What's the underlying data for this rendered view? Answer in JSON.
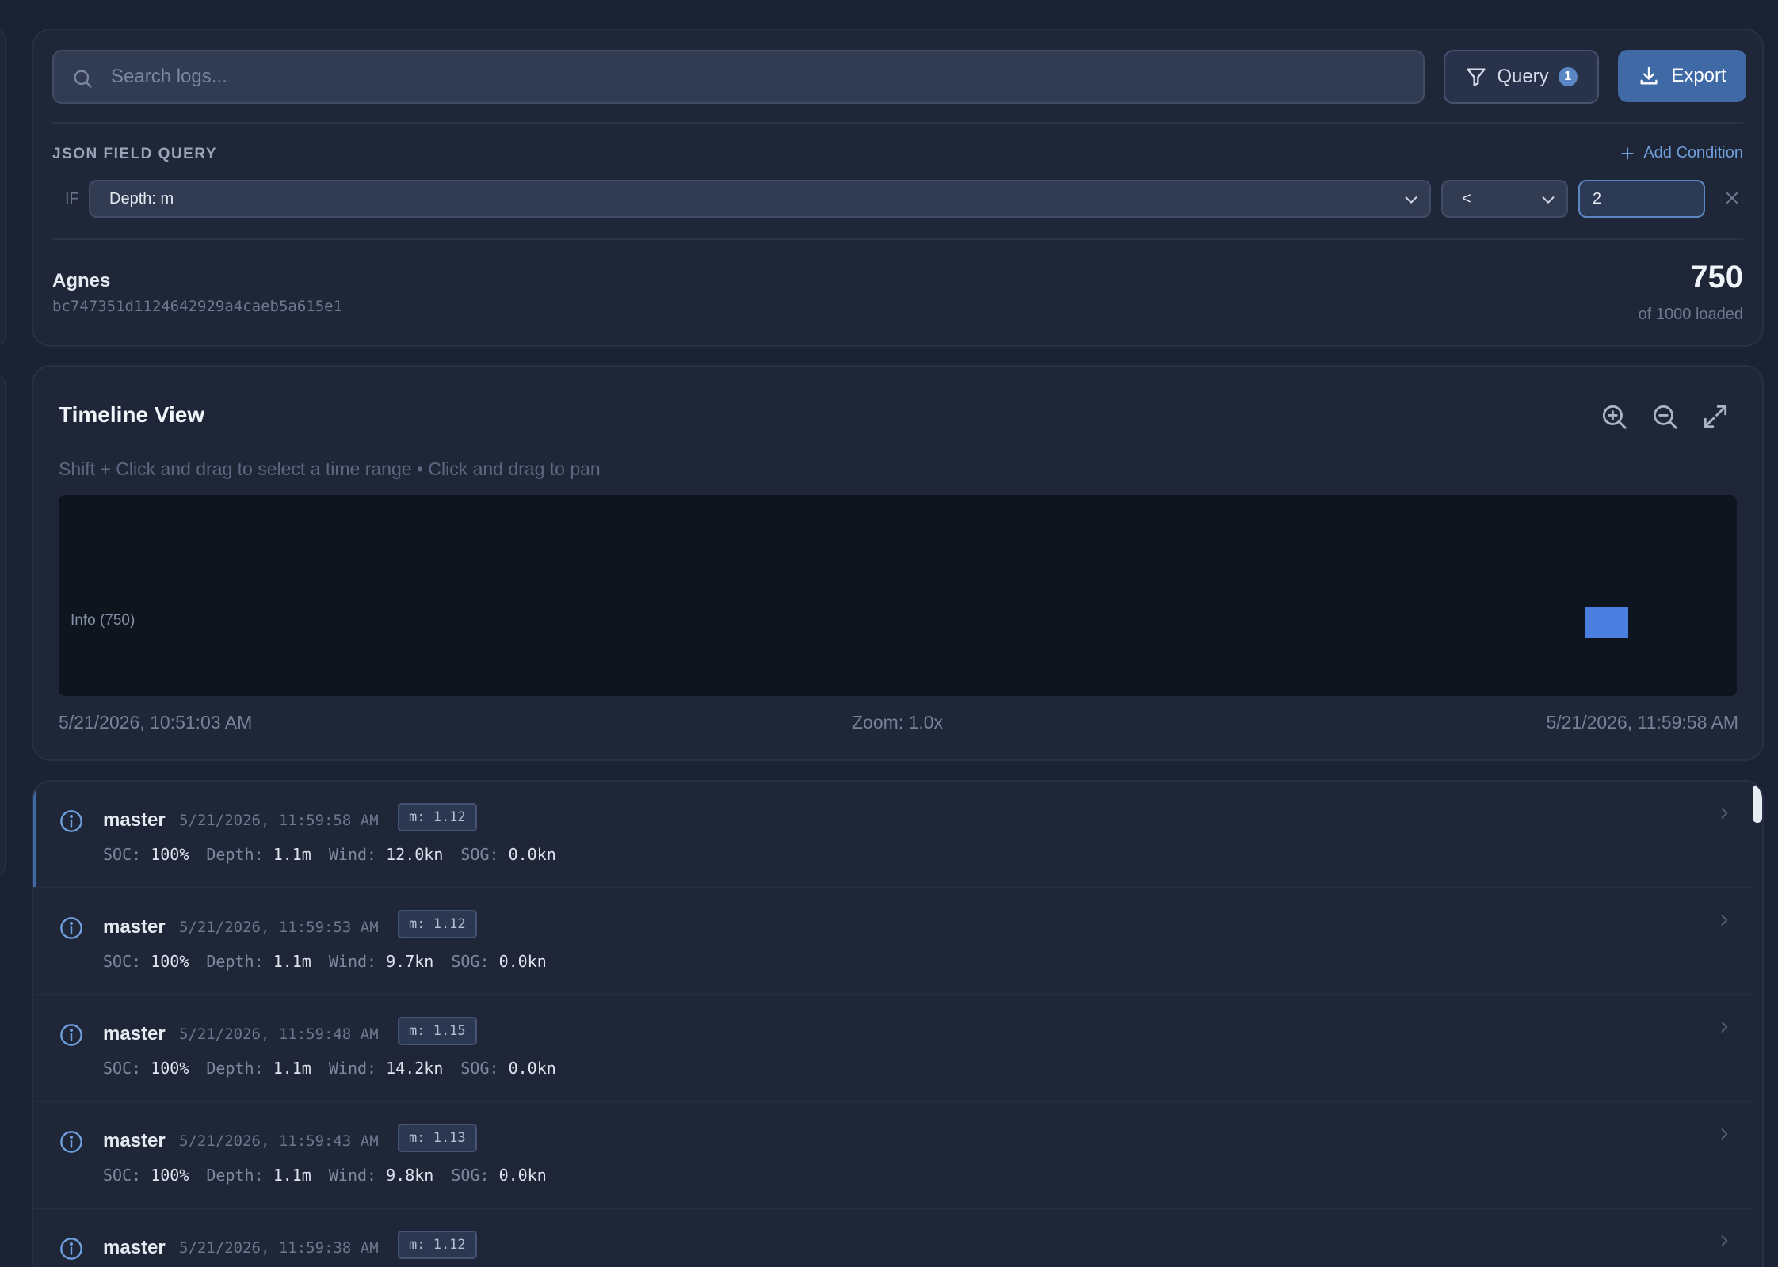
{
  "search": {
    "placeholder": "Search logs..."
  },
  "toolbar": {
    "query_label": "Query",
    "query_count": "1",
    "export_label": "Export"
  },
  "json_query": {
    "title": "JSON FIELD QUERY",
    "add_label": "Add Condition",
    "if_label": "IF",
    "field": "Depth: m",
    "operator": "<",
    "value": "2"
  },
  "source": {
    "name": "Agnes",
    "id": "bc747351d1124642929a4caeb5a615e1"
  },
  "counts": {
    "shown": "750",
    "loaded_text": "of 1000 loaded"
  },
  "timeline": {
    "title": "Timeline View",
    "hint": "Shift + Click and drag to select a time range • Click and drag to pan",
    "series_label": "Info (750)",
    "start": "5/21/2026, 10:51:03 AM",
    "zoom": "Zoom: 1.0x",
    "end": "5/21/2026, 11:59:58 AM",
    "colors": {
      "bar": "#4a7fe0",
      "canvas": "#0f151f"
    },
    "icons": [
      "zoom-in-icon",
      "zoom-out-icon",
      "expand-icon"
    ]
  },
  "logs": [
    {
      "source": "master",
      "time": "5/21/2026, 11:59:58 AM",
      "tag": "m: 1.12",
      "soc_k": "SOC:",
      "soc": "100%",
      "depth_k": "Depth:",
      "depth": "1.1m",
      "wind_k": "Wind:",
      "wind": "12.0kn",
      "sog_k": "SOG:",
      "sog": "0.0kn"
    },
    {
      "source": "master",
      "time": "5/21/2026, 11:59:53 AM",
      "tag": "m: 1.12",
      "soc_k": "SOC:",
      "soc": "100%",
      "depth_k": "Depth:",
      "depth": "1.1m",
      "wind_k": "Wind:",
      "wind": "9.7kn",
      "sog_k": "SOG:",
      "sog": "0.0kn"
    },
    {
      "source": "master",
      "time": "5/21/2026, 11:59:48 AM",
      "tag": "m: 1.15",
      "soc_k": "SOC:",
      "soc": "100%",
      "depth_k": "Depth:",
      "depth": "1.1m",
      "wind_k": "Wind:",
      "wind": "14.2kn",
      "sog_k": "SOG:",
      "sog": "0.0kn"
    },
    {
      "source": "master",
      "time": "5/21/2026, 11:59:43 AM",
      "tag": "m: 1.13",
      "soc_k": "SOC:",
      "soc": "100%",
      "depth_k": "Depth:",
      "depth": "1.1m",
      "wind_k": "Wind:",
      "wind": "9.8kn",
      "sog_k": "SOG:",
      "sog": "0.0kn"
    },
    {
      "source": "master",
      "time": "5/21/2026, 11:59:38 AM",
      "tag": "m: 1.12",
      "soc_k": "",
      "soc": "",
      "depth_k": "",
      "depth": "",
      "wind_k": "",
      "wind": "",
      "sog_k": "",
      "sog": ""
    }
  ]
}
